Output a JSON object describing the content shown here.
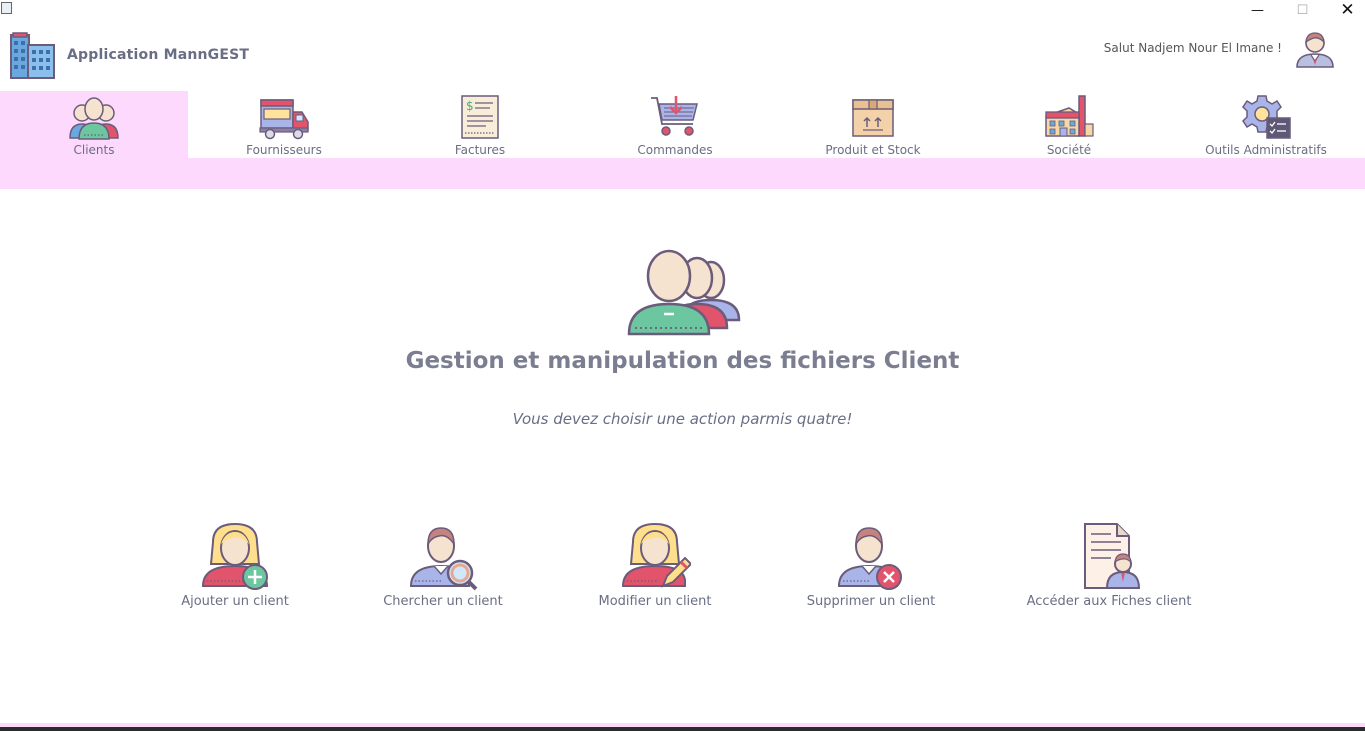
{
  "window": {
    "minimize": "—",
    "maximize": "☐",
    "close": "✕"
  },
  "header": {
    "app_title": "Application MannGEST",
    "greeting": "Salut Nadjem Nour El Imane !"
  },
  "nav": [
    {
      "label": "Clients",
      "icon": "clients-icon",
      "active": true
    },
    {
      "label": "Fournisseurs",
      "icon": "truck-icon"
    },
    {
      "label": "Factures",
      "icon": "invoice-icon"
    },
    {
      "label": "Commandes",
      "icon": "cart-icon"
    },
    {
      "label": "Produit et Stock",
      "icon": "box-icon"
    },
    {
      "label": "Société",
      "icon": "factory-icon"
    },
    {
      "label": "Outils Administratifs",
      "icon": "settings-icon"
    }
  ],
  "main": {
    "title": "Gestion et manipulation des fichiers Client",
    "subtitle": "Vous devez choisir une action parmis quatre!",
    "actions": [
      {
        "label": "Ajouter un client",
        "icon": "add-client-icon"
      },
      {
        "label": "Chercher un client",
        "icon": "search-client-icon"
      },
      {
        "label": "Modifier un client",
        "icon": "edit-client-icon"
      },
      {
        "label": "Supprimer un client",
        "icon": "delete-client-icon"
      },
      {
        "label": "Accéder aux Fiches client",
        "icon": "client-files-icon"
      }
    ]
  },
  "colors": {
    "accent_pink": "#fdd9fe",
    "text": "#6a6e85",
    "icon_outline": "#6b5c7b",
    "icon_green": "#6cc6a0",
    "icon_red": "#e2546c",
    "icon_blue": "#6aa9e0",
    "icon_skin": "#f6e3cf"
  }
}
